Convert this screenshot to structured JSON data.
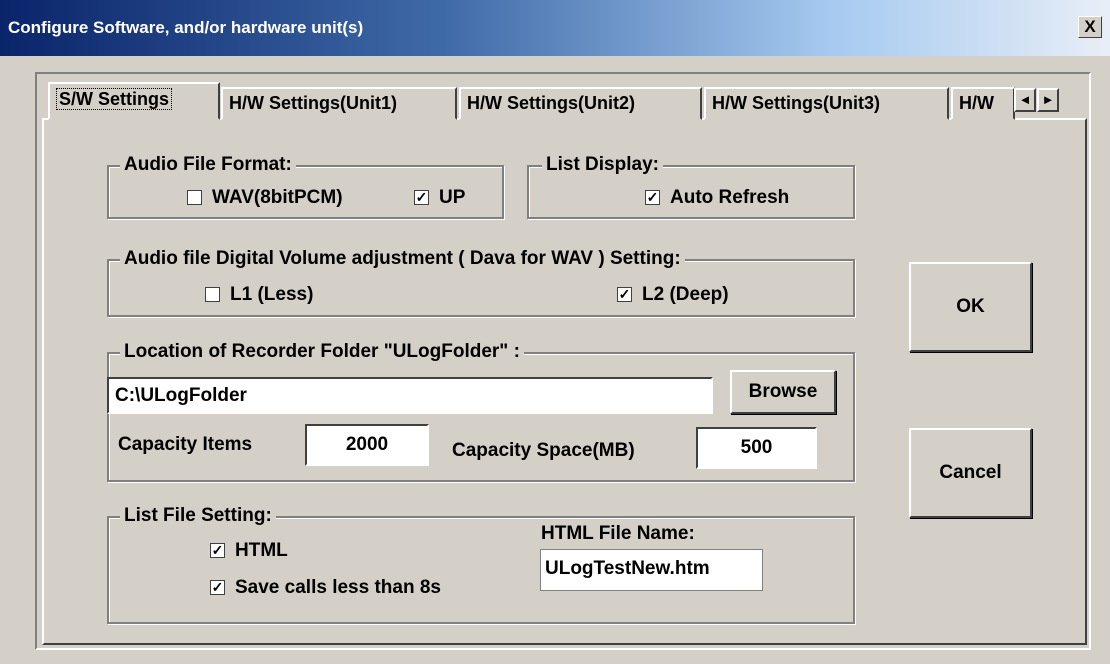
{
  "window": {
    "title": "Configure Software, and/or hardware unit(s)",
    "close_label": "X"
  },
  "tabs": [
    {
      "label": "S/W Settings",
      "active": true
    },
    {
      "label": "H/W Settings(Unit1)"
    },
    {
      "label": "H/W Settings(Unit2)"
    },
    {
      "label": "H/W Settings(Unit3)"
    },
    {
      "label": "H/W"
    }
  ],
  "tab_scroll": {
    "left": "◄",
    "right": "►"
  },
  "audio_format": {
    "legend": "Audio File Format:",
    "wav_label": "WAV(8bitPCM)",
    "wav_checked": false,
    "up_label": "UP",
    "up_checked": true
  },
  "list_display": {
    "legend": "List Display:",
    "auto_refresh_label": "Auto Refresh",
    "auto_refresh_checked": true
  },
  "volume": {
    "legend": "Audio file Digital Volume adjustment ( Dava for WAV ) Setting:",
    "l1_label": "L1 (Less)",
    "l1_checked": false,
    "l2_label": "L2 (Deep)",
    "l2_checked": true
  },
  "location": {
    "legend": "Location of Recorder Folder \"ULogFolder\" :",
    "path": "C:\\ULogFolder",
    "browse_label": "Browse",
    "capacity_items_label": "Capacity Items",
    "capacity_items": "2000",
    "capacity_space_label": "Capacity Space(MB)",
    "capacity_space": "500"
  },
  "list_file": {
    "legend": "List File Setting:",
    "html_label": "HTML",
    "html_checked": true,
    "save_label": "Save calls less than 8s",
    "save_checked": true,
    "filename_label": "HTML File Name:",
    "filename": "ULogTestNew.htm"
  },
  "buttons": {
    "ok": "OK",
    "cancel": "Cancel"
  },
  "check_mark": "✓"
}
